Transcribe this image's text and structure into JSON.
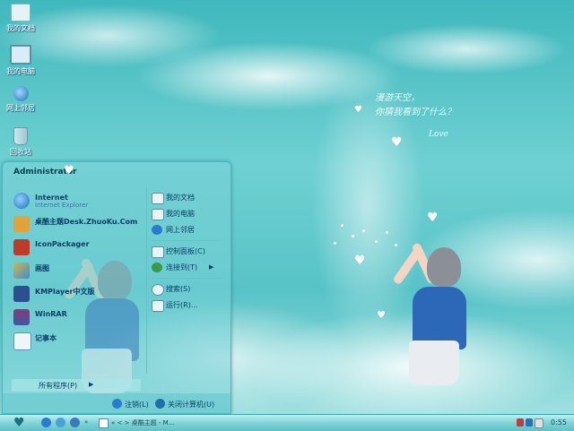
{
  "colors": {
    "accent": "#5fc2c6",
    "text_dark": "#0b3f66",
    "wallpaper": "#57c3c7"
  },
  "desktop": {
    "icons": [
      {
        "label": "我的文档",
        "icon": "folder-icon"
      },
      {
        "label": "我的电脑",
        "icon": "computer-icon"
      },
      {
        "label": "网上邻居",
        "icon": "network-globe-icon"
      },
      {
        "label": "回收站",
        "icon": "recycle-bin-icon"
      }
    ],
    "wallpaper_text": {
      "line1": "漫游天空，",
      "line2": "你猜我看到了什么？",
      "love": "Love"
    }
  },
  "start_menu": {
    "user": "Administrator",
    "programs": [
      {
        "name": "Internet",
        "sub": "Internet Explorer",
        "icon": "internet-explorer-icon",
        "color": "#2a7bd0"
      },
      {
        "name": "桌酷主题Desk.ZhuoKu.Com",
        "sub": "",
        "icon": "zhuoku-theme-icon",
        "color": "#e0a23a"
      },
      {
        "name": "IconPackager",
        "sub": "",
        "icon": "iconpackager-icon",
        "color": "#c03a2a"
      },
      {
        "name": "画图",
        "sub": "",
        "icon": "paint-icon",
        "color": "#d9b24a"
      },
      {
        "name": "KMPlayer中文版",
        "sub": "",
        "icon": "kmplayer-icon",
        "color": "#2b4f8f"
      },
      {
        "name": "WinRAR",
        "sub": "",
        "icon": "winrar-icon",
        "color": "#8a3a7a"
      },
      {
        "name": "记事本",
        "sub": "",
        "icon": "notepad-icon",
        "color": "#5a8fc0"
      }
    ],
    "right_items": [
      {
        "label": "我的文档",
        "icon": "folder-icon",
        "color": "#e8f4f6"
      },
      {
        "label": "我的电脑",
        "icon": "computer-icon",
        "color": "#e8f4f6"
      },
      {
        "label": "网上邻居",
        "icon": "network-globe-icon",
        "color": "#2a7bd0"
      },
      {
        "label": "控制面板(C)",
        "icon": "control-panel-icon",
        "color": "#e8f4f6"
      },
      {
        "label": "连接到(T)",
        "icon": "connect-to-icon",
        "color": "#3a9a4a"
      },
      {
        "label": "搜索(S)",
        "icon": "search-icon",
        "color": "#e8f4f6"
      },
      {
        "label": "运行(R)...",
        "icon": "run-icon",
        "color": "#e8f4f6"
      }
    ],
    "all_programs": "所有程序(P)",
    "logoff": "注销(L)",
    "shutdown": "关闭计算机(U)"
  },
  "taskbar": {
    "task": "« < > 桌酷主题 - M...",
    "time": "0:55"
  }
}
